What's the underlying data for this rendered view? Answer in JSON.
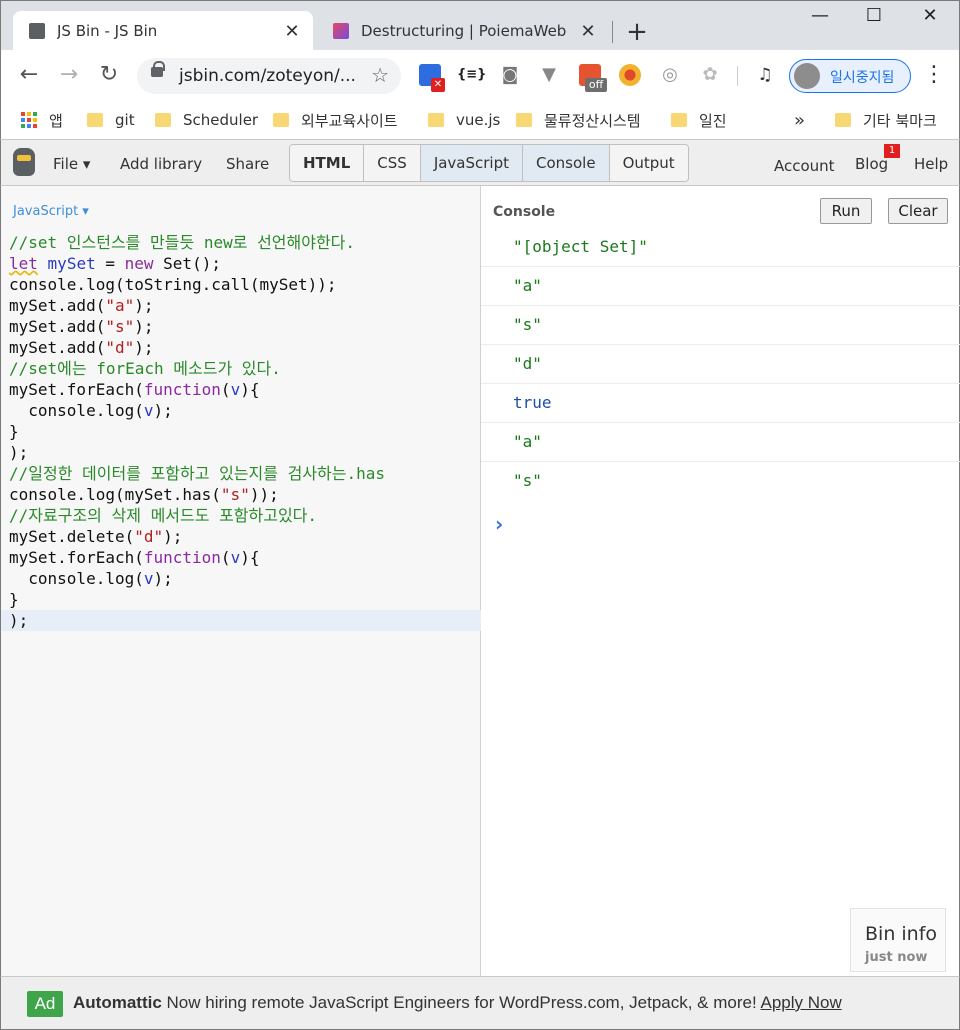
{
  "browser": {
    "tabs": [
      {
        "title": "JS Bin - JS Bin",
        "active": true
      },
      {
        "title": "Destructuring | PoiemaWeb",
        "active": false
      }
    ],
    "url": "jsbin.com/zoteyon/...",
    "profile_label": "일시중지됨",
    "extension_off_label": "off",
    "bookmarks": [
      "앱",
      "git",
      "Scheduler",
      "외부교육사이트",
      "vue.js",
      "물류정산시스템",
      "일진"
    ],
    "bookmarks_overflow": "»",
    "other_bookmarks": "기타 북마크"
  },
  "jsbin": {
    "menu": {
      "file": "File ▾",
      "add_library": "Add library",
      "share": "Share"
    },
    "panels": [
      "HTML",
      "CSS",
      "JavaScript",
      "Console",
      "Output"
    ],
    "right_links": {
      "account": "Account",
      "blog": "Blog",
      "blog_badge": "1",
      "help": "Help"
    }
  },
  "editor": {
    "language": "JavaScript ▾"
  },
  "console": {
    "title": "Console",
    "run_label": "Run",
    "clear_label": "Clear",
    "outputs": [
      "\"[object Set]\"",
      "\"a\"",
      "\"s\"",
      "\"d\"",
      "true",
      "\"a\"",
      "\"s\""
    ],
    "prompt": "›"
  },
  "bin_info": {
    "title": "Bin info",
    "subtitle": "just now"
  },
  "ad": {
    "badge": "Ad",
    "brand": "Automattic",
    "text": " Now hiring remote JavaScript Engineers for WordPress.com, Jetpack, & more! ",
    "link": "Apply Now"
  },
  "colors": {
    "accent": "#3e8fd8",
    "console_string": "#1a7a1a",
    "ad_badge": "#3ea54a"
  }
}
